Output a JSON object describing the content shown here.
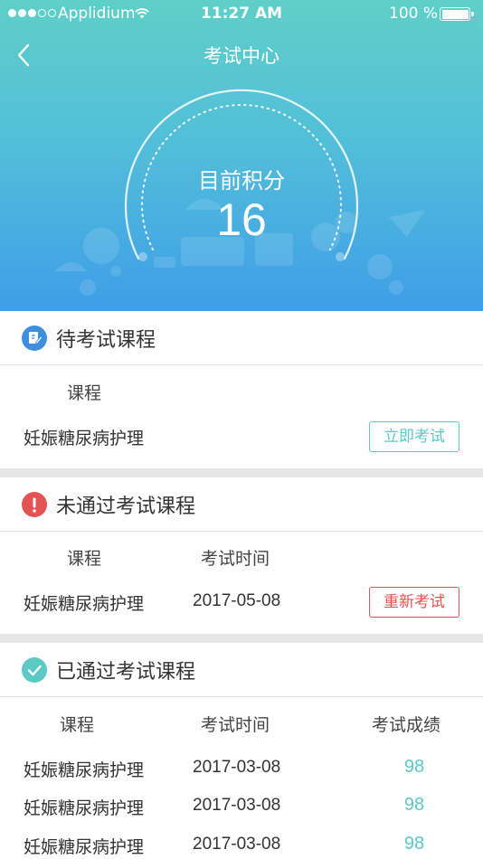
{
  "status_bar": {
    "carrier": "Applidium",
    "time": "11:27 AM",
    "battery": "100 %"
  },
  "nav": {
    "title": "考试中心",
    "back_icon": "chevron-left-icon"
  },
  "score": {
    "label": "目前积分",
    "value": "16"
  },
  "pending": {
    "title": "待考试课程",
    "icon": "edit-document-icon",
    "col_course": "课程",
    "rows": [
      {
        "course": "妊娠糖尿病护理",
        "action": "立即考试"
      }
    ]
  },
  "failed": {
    "title": "未通过考试课程",
    "icon": "exclamation-icon",
    "col_course": "课程",
    "col_time": "考试时间",
    "rows": [
      {
        "course": "妊娠糖尿病护理",
        "time": "2017-05-08",
        "action": "重新考试"
      }
    ]
  },
  "passed": {
    "title": "已通过考试课程",
    "icon": "checkmark-icon",
    "col_course": "课程",
    "col_time": "考试时间",
    "col_score": "考试成绩",
    "rows": [
      {
        "course": "妊娠糖尿病护理",
        "time": "2017-03-08",
        "score": "98"
      },
      {
        "course": "妊娠糖尿病护理",
        "time": "2017-03-08",
        "score": "98"
      },
      {
        "course": "妊娠糖尿病护理",
        "time": "2017-03-08",
        "score": "98"
      }
    ]
  },
  "colors": {
    "accent": "#5cc9c4",
    "danger": "#e45353",
    "info": "#3f8fe0"
  }
}
